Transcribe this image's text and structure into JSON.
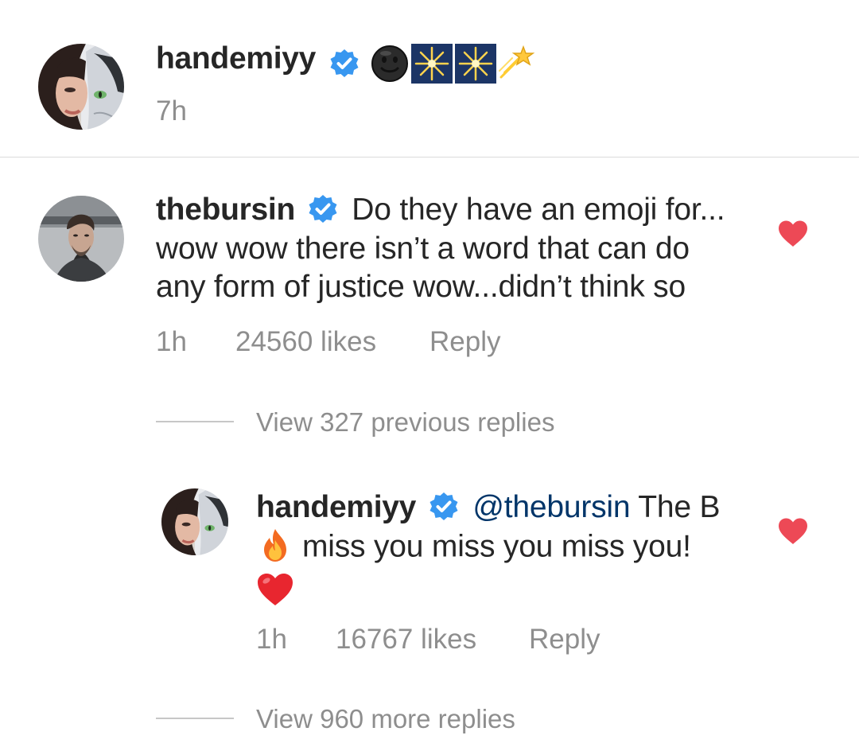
{
  "post": {
    "username": "handemiyy",
    "time": "7h",
    "caption_emojis": [
      "new-moon-face-emoji",
      "sparkler-emoji",
      "sparkler-emoji",
      "shooting-star-emoji"
    ]
  },
  "comments": [
    {
      "username": "thebursin",
      "text_line1": "Do they have an emoji for...",
      "text_line2": "wow wow there isn’t a word that can do",
      "text_line3": "any form of justice wow...didn’t think so",
      "time": "1h",
      "likes": "24560 likes",
      "reply_label": "Reply",
      "view_previous": "View 327 previous replies"
    },
    {
      "username": "handemiyy",
      "mention": "@thebursin",
      "text_after_mention": " The B",
      "text_line2": "miss you miss you miss you!",
      "emoji_fire": "fire-emoji",
      "emoji_heart": "red-heart-emoji",
      "time": "1h",
      "likes": "16767 likes",
      "reply_label": "Reply",
      "view_more": "View 960 more replies"
    }
  ],
  "colors": {
    "text": "#262626",
    "meta": "#8e8e8e",
    "verified": "#3897f0",
    "heart": "#ed4956",
    "mention": "#003569",
    "divider": "#dbdbdb"
  },
  "icons": {
    "verified": "verified-badge-icon",
    "like": "heart-icon"
  }
}
